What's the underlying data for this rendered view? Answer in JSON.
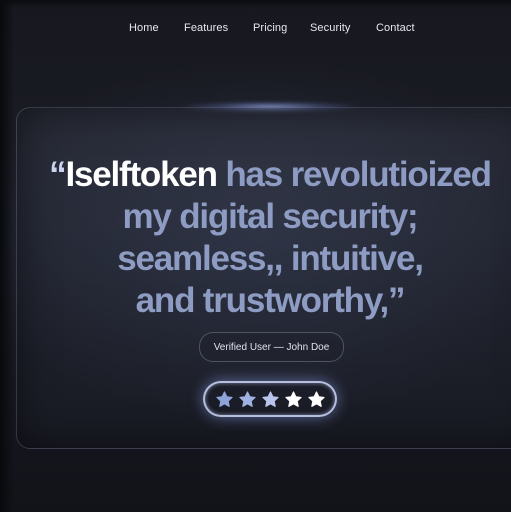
{
  "nav": {
    "items": [
      {
        "label": "Home"
      },
      {
        "label": "Features"
      },
      {
        "label": "Pricing"
      },
      {
        "label": "Security"
      },
      {
        "label": "Contact"
      }
    ]
  },
  "testimonial": {
    "open_quote": "“",
    "brand": "Iselftoken",
    "line1_rest": " has revolutioized",
    "line2": "my digital security;",
    "line3": "seamless,, intuitive,",
    "line4": "and trustworthy,”",
    "attribution": "Verified User — John Doe"
  },
  "rating": {
    "value": 5,
    "max": 5,
    "star_colors": [
      "#8fa3db",
      "#9fb0e2",
      "#b7c4ec",
      "#ffffff",
      "#ffffff"
    ]
  },
  "colors": {
    "quote_text": "#8e9cc4",
    "brand_text": "#ffffff",
    "glow": "#aabeff"
  }
}
